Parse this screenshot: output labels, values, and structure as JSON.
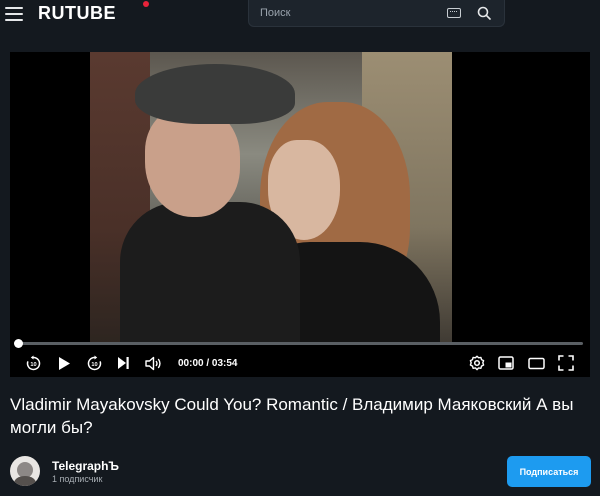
{
  "header": {
    "logo": "RUTUBE",
    "search_placeholder": "Поиск",
    "icons": [
      "menu-icon",
      "keyboard-icon",
      "search-icon"
    ]
  },
  "player": {
    "progress": 0,
    "time": "00:00 / 03:54",
    "controls": [
      "rewind-10-icon",
      "play-icon",
      "forward-10-icon",
      "skip-next-icon",
      "volume-icon",
      "settings-icon",
      "picture-in-picture-icon",
      "theater-mode-icon",
      "fullscreen-icon"
    ]
  },
  "video": {
    "title": "Vladimir Mayakovsky Could You? Romantic / Владимир Маяковский А вы могли бы?"
  },
  "channel": {
    "name": "TelegraphЪ",
    "subscribers": "1 подписчик",
    "subscribe_label": "Подписаться"
  },
  "colors": {
    "background": "#14191f",
    "accent": "#1d9bf0",
    "logo_dot": "#e8233a"
  }
}
